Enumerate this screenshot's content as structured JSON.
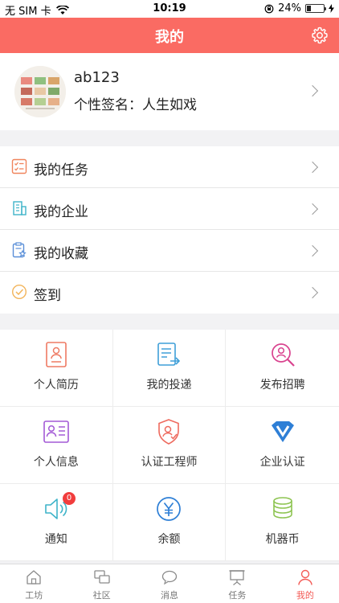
{
  "status_bar": {
    "carrier": "无 SIM 卡",
    "time": "10:19",
    "battery": "24%",
    "battery_level": 0.24
  },
  "header": {
    "title": "我的"
  },
  "profile": {
    "username": "ab123",
    "signature": "个性签名：人生如戏"
  },
  "menu": [
    {
      "label": "我的任务",
      "icon": "task-list-icon"
    },
    {
      "label": "我的企业",
      "icon": "building-icon"
    },
    {
      "label": "我的收藏",
      "icon": "favorite-icon"
    },
    {
      "label": "签到",
      "icon": "checkin-icon"
    }
  ],
  "grid": [
    {
      "label": "个人简历",
      "icon": "resume-icon"
    },
    {
      "label": "我的投递",
      "icon": "delivery-icon"
    },
    {
      "label": "发布招聘",
      "icon": "recruit-search-icon"
    },
    {
      "label": "个人信息",
      "icon": "id-card-icon"
    },
    {
      "label": "认证工程师",
      "icon": "shield-engineer-icon"
    },
    {
      "label": "企业认证",
      "icon": "vip-badge-icon"
    },
    {
      "label": "通知",
      "icon": "speaker-icon",
      "badge": "0"
    },
    {
      "label": "余额",
      "icon": "yuan-icon"
    },
    {
      "label": "机器币",
      "icon": "coin-stack-icon"
    }
  ],
  "tabs": [
    {
      "label": "工坊",
      "icon": "home-icon"
    },
    {
      "label": "社区",
      "icon": "community-icon"
    },
    {
      "label": "消息",
      "icon": "message-icon"
    },
    {
      "label": "任务",
      "icon": "task-board-icon"
    },
    {
      "label": "我的",
      "icon": "person-icon",
      "active": true
    }
  ],
  "colors": {
    "accent": "#fa6b63",
    "active_tab": "#f35a55",
    "badge": "#f13d3d"
  }
}
